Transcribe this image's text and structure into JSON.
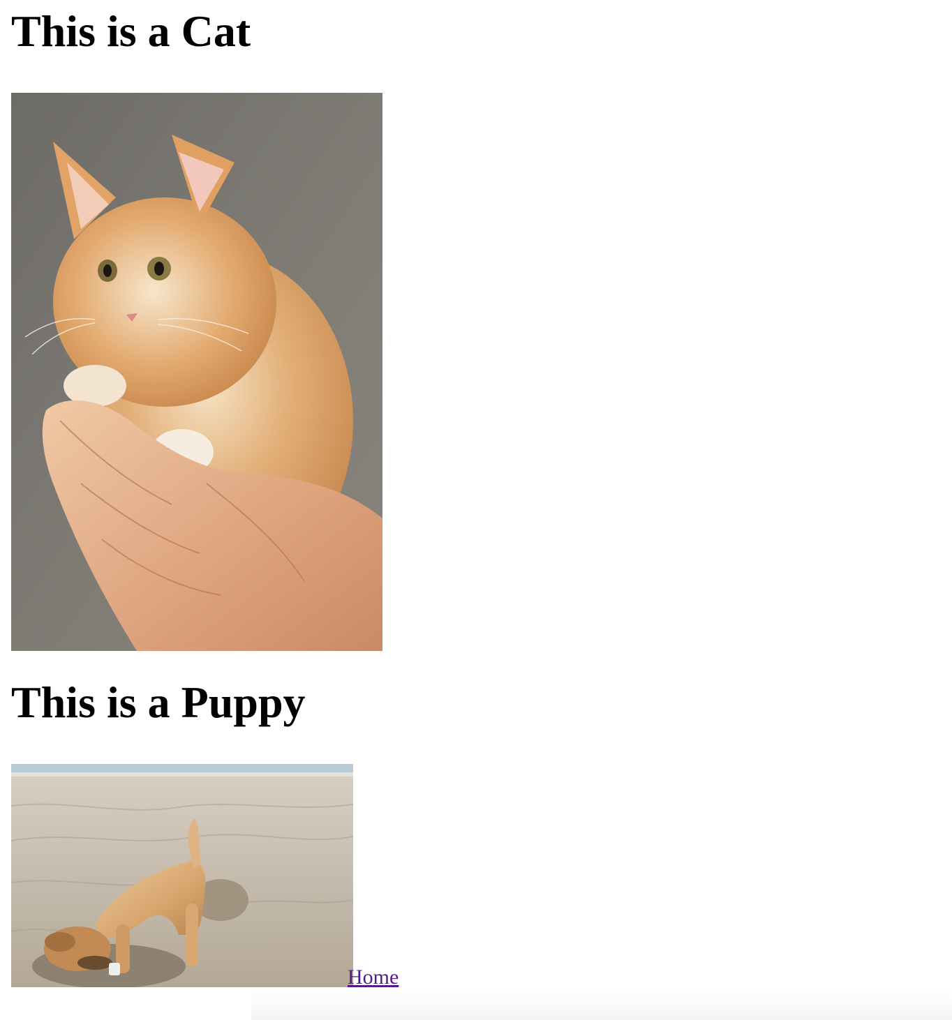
{
  "sections": [
    {
      "heading": "This is a Cat",
      "image_subject": "kitten-held-in-hand"
    },
    {
      "heading": "This is a Puppy",
      "image_subject": "puppy-digging-in-sand"
    }
  ],
  "nav": {
    "home_label": "Home"
  },
  "colors": {
    "text": "#000000",
    "link_visited": "#551a8b",
    "background": "#ffffff"
  }
}
